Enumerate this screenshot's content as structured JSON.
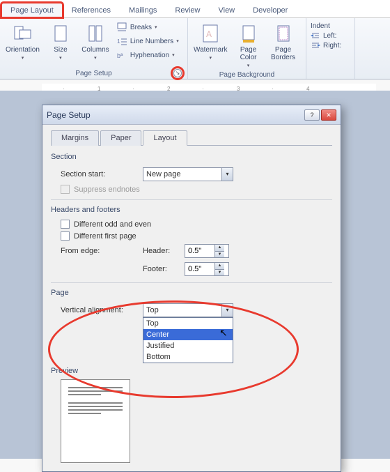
{
  "ribbon": {
    "tabs": {
      "page_layout": "Page Layout",
      "references": "References",
      "mailings": "Mailings",
      "review": "Review",
      "view": "View",
      "developer": "Developer"
    },
    "page_setup": {
      "group_label": "Page Setup",
      "orientation": "Orientation",
      "size": "Size",
      "columns": "Columns",
      "breaks": "Breaks",
      "line_numbers": "Line Numbers",
      "hyphenation": "Hyphenation"
    },
    "page_background": {
      "group_label": "Page Background",
      "watermark": "Watermark",
      "page_color": "Page\nColor",
      "page_borders": "Page\nBorders"
    },
    "paragraph": {
      "indent": "Indent",
      "left": "Left:",
      "right": "Right:"
    }
  },
  "dialog": {
    "title": "Page Setup",
    "tabs": {
      "margins": "Margins",
      "paper": "Paper",
      "layout": "Layout"
    },
    "section": {
      "heading": "Section",
      "start_label": "Section start:",
      "start_value": "New page",
      "suppress": "Suppress endnotes"
    },
    "hf": {
      "heading": "Headers and footers",
      "diff_oe": "Different odd and even",
      "diff_first": "Different first page",
      "from_edge": "From edge:",
      "header_label": "Header:",
      "header_value": "0.5\"",
      "footer_label": "Footer:",
      "footer_value": "0.5\""
    },
    "page": {
      "heading": "Page",
      "valign_label": "Vertical alignment:",
      "valign_value": "Top",
      "options": {
        "top": "Top",
        "center": "Center",
        "justified": "Justified",
        "bottom": "Bottom"
      }
    },
    "preview": {
      "heading": "Preview"
    }
  }
}
